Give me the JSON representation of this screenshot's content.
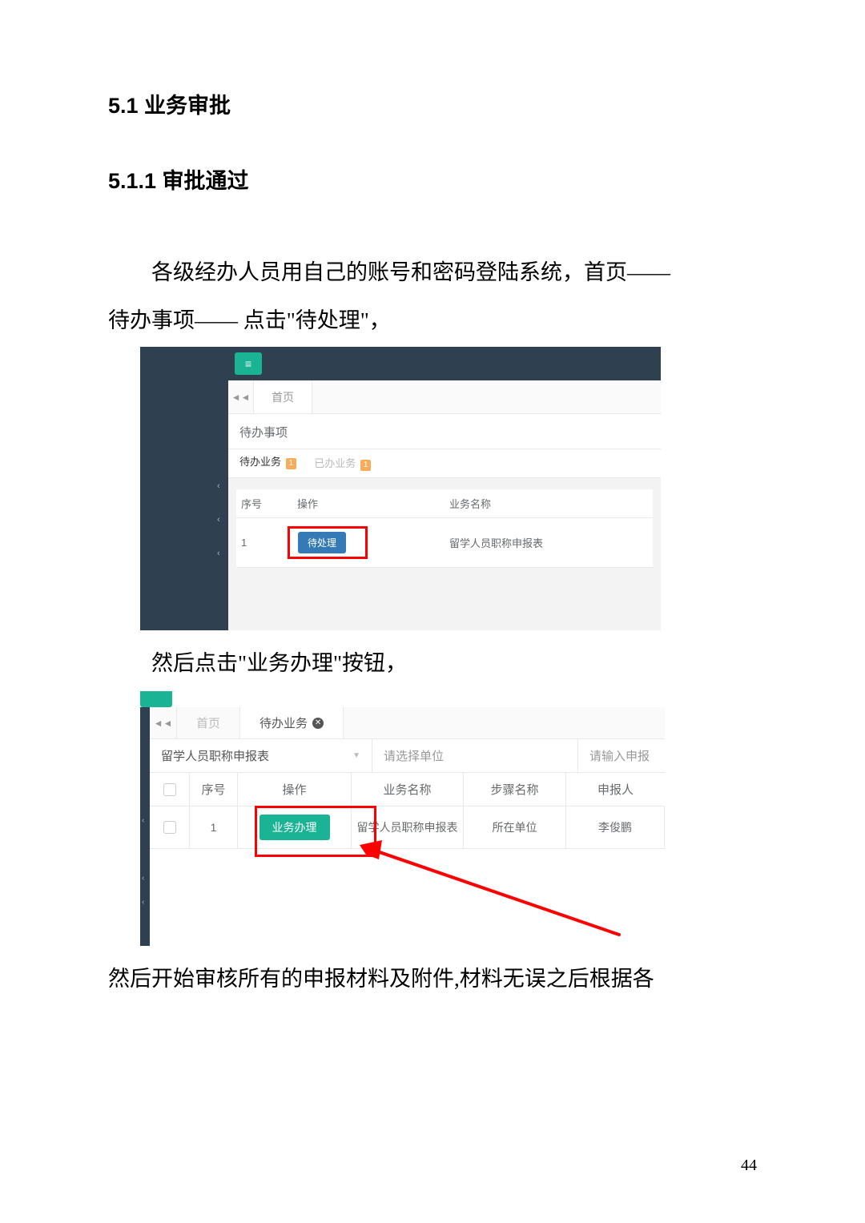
{
  "headings": {
    "h1": "5.1 业务审批",
    "h2": "5.1.1 审批通过"
  },
  "paragraphs": {
    "p1a": "各级经办人员用自己的账号和密码登陆系统，首页——",
    "p1b": "待办事项—— 点击\"待处理\"，",
    "p2": "然后点击\"业务办理\"按钮，",
    "p3": "然后开始审核所有的申报材料及附件,材料无误之后根据各"
  },
  "page_number": "44",
  "shot1": {
    "tab_home": "首页",
    "section_title": "待办事项",
    "subtab_pending": "待办业务",
    "subtab_done": "已办业务",
    "badge_count": "1",
    "th_seq": "序号",
    "th_op": "操作",
    "th_name": "业务名称",
    "row_seq": "1",
    "btn_pending": "待处理",
    "row_name": "留学人员职称申报表"
  },
  "shot2": {
    "tab_home": "首页",
    "tab_pending": "待办业务",
    "filter_form": "留学人员职称申报表",
    "filter_unit_placeholder": "请选择单位",
    "filter_applicant_placeholder": "请输入申报",
    "th_seq": "序号",
    "th_op": "操作",
    "th_name": "业务名称",
    "th_step": "步骤名称",
    "th_person": "申报人",
    "row_seq": "1",
    "btn_process": "业务办理",
    "row_name": "留学人员职称申报表",
    "row_step": "所在单位",
    "row_person": "李俊鹏"
  }
}
